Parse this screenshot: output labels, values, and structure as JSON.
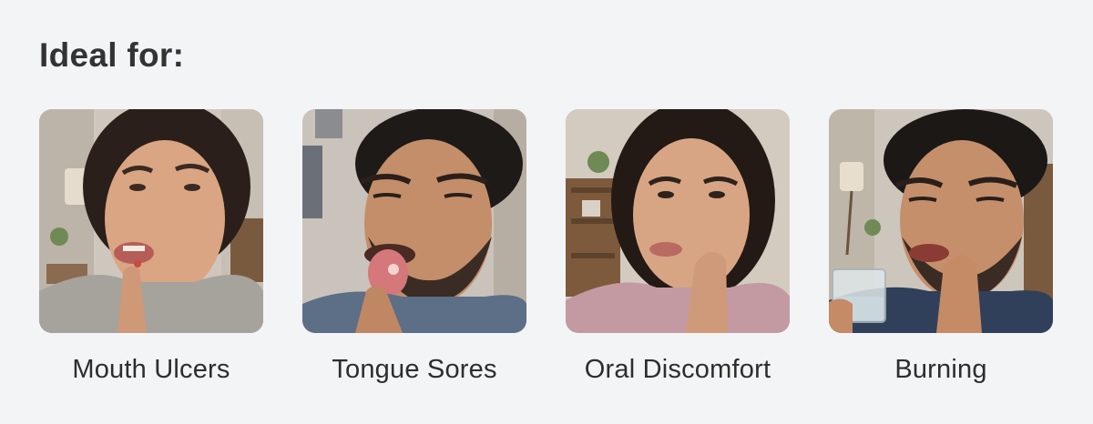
{
  "heading": "Ideal for:",
  "cards": [
    {
      "label": "Mouth Ulcers",
      "image": "woman-touching-lip-ulcer"
    },
    {
      "label": "Tongue Sores",
      "image": "man-showing-tongue-sore"
    },
    {
      "label": "Oral Discomfort",
      "image": "woman-holding-cheek"
    },
    {
      "label": "Burning",
      "image": "man-holding-mouth-with-water-glass"
    }
  ],
  "colors": {
    "background": "#f3f4f6",
    "text": "#2d2d2d"
  }
}
